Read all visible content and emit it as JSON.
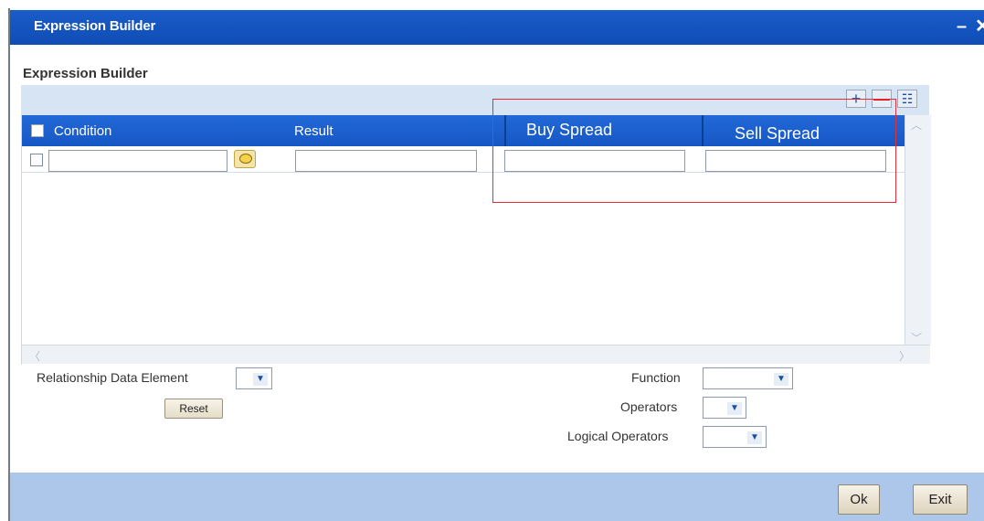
{
  "window": {
    "title": "Expression Builder",
    "minimize_glyph": "–",
    "close_glyph": "✕"
  },
  "section": {
    "title": "Expression Builder"
  },
  "toolbar": {
    "add_glyph": "+",
    "delete_glyph": "—",
    "grid_glyph": "☷"
  },
  "grid": {
    "columns": [
      "Condition",
      "Result",
      "Buy Spread",
      "Sell Spread"
    ],
    "rows": [
      {
        "condition": "",
        "result": "",
        "buy_spread": "",
        "sell_spread": ""
      }
    ]
  },
  "form": {
    "relationship_label": "Relationship Data Element",
    "relationship_value": "",
    "reset_label": "Reset",
    "function_label": "Function",
    "function_value": "",
    "operators_label": "Operators",
    "operators_value": "",
    "logical_label": "Logical Operators",
    "logical_value": ""
  },
  "footer": {
    "ok_label": "Ok",
    "exit_label": "Exit"
  },
  "colors": {
    "titlebar": "#1657c4",
    "header": "#2368d8",
    "footer": "#adc7ea",
    "highlight": "#e2303a"
  }
}
